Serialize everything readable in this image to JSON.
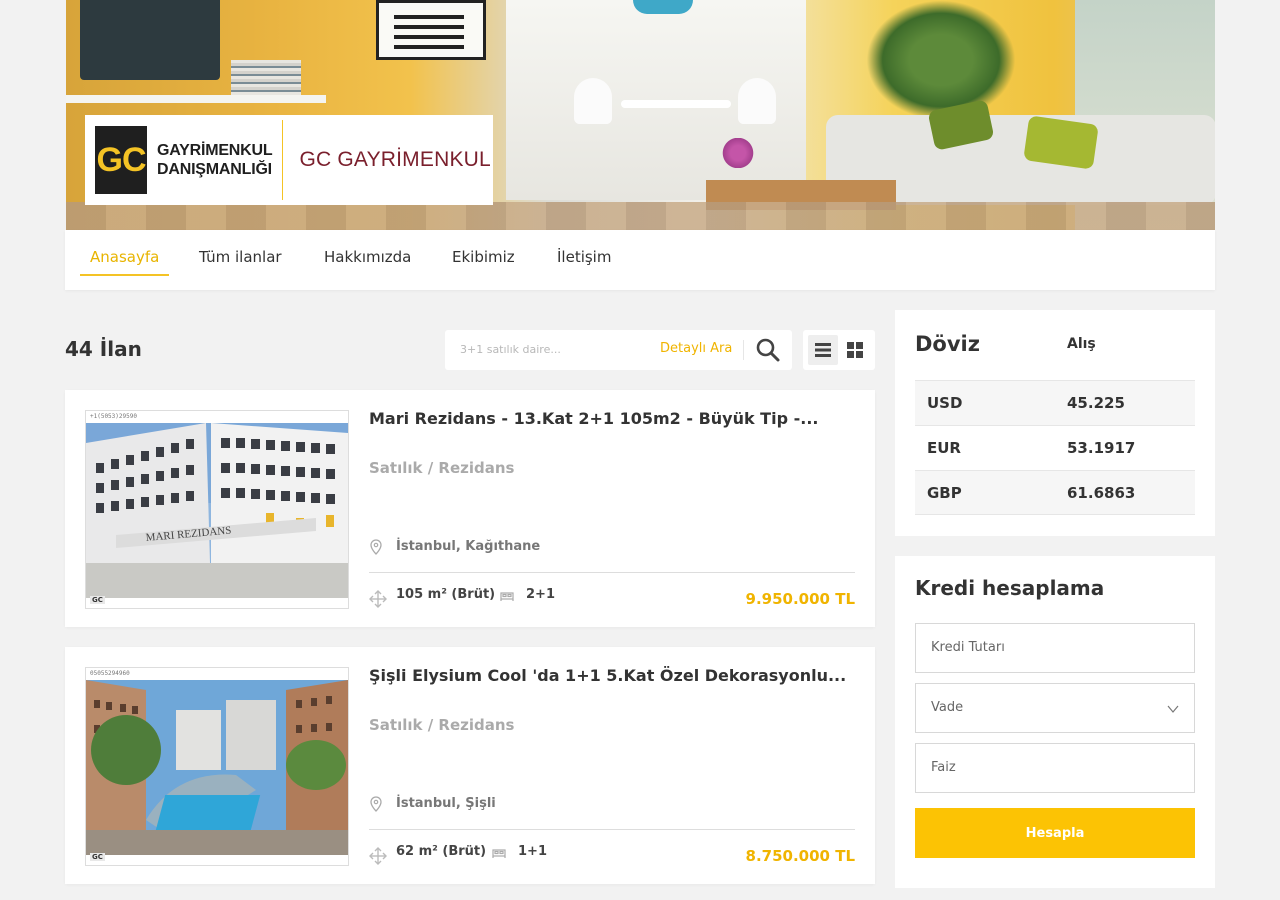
{
  "brand": {
    "logo_mark": "GC",
    "logo_line1": "GAYRİMENKUL",
    "logo_line2": "DANIŞMANLIĞI",
    "name": "GC GAYRİMENKUL"
  },
  "nav": {
    "items": [
      {
        "label": "Anasayfa",
        "active": true
      },
      {
        "label": "Tüm ilanlar",
        "active": false
      },
      {
        "label": "Hakkımızda",
        "active": false
      },
      {
        "label": "Ekibimiz",
        "active": false
      },
      {
        "label": "İletişim",
        "active": false
      }
    ]
  },
  "listing": {
    "count": "44 İlan",
    "search": {
      "placeholder": "3+1 satılık daire...",
      "detail_label": "Detaylı Ara"
    },
    "view_modes": [
      "list-icon",
      "grid-icon"
    ],
    "cards": [
      {
        "title": "Mari Rezidans - 13.Kat 2+1 105m2 - Büyük Tip -...",
        "type": "Satılık / Rezidans",
        "location": "İstanbul, Kağıthane",
        "area": "105 m² (Brüt)",
        "rooms": "2+1",
        "price": "9.950.000 TL",
        "img_code": "+1(5053)29590",
        "img_stamp": "GC"
      },
      {
        "title": "Şişli Elysium Cool 'da 1+1 5.Kat Özel Dekorasyonlu...",
        "type": "Satılık / Rezidans",
        "location": "İstanbul, Şişli",
        "area": "62 m² (Brüt)",
        "rooms": "1+1",
        "price": "8.750.000 TL",
        "img_code": "05055294960",
        "img_stamp": "GC"
      }
    ]
  },
  "fx": {
    "title": "Döviz",
    "column": "Alış",
    "rows": [
      {
        "currency": "USD",
        "rate": "45.225"
      },
      {
        "currency": "EUR",
        "rate": "53.1917"
      },
      {
        "currency": "GBP",
        "rate": "61.6863"
      }
    ]
  },
  "loan": {
    "title": "Kredi hesaplama",
    "amount_placeholder": "Kredi Tutarı",
    "term_placeholder": "Vade",
    "rate_placeholder": "Faiz",
    "button": "Hesapla"
  },
  "colors": {
    "accent": "#fcc304",
    "price": "#f0b400",
    "brand_red": "#7a1f2c"
  }
}
